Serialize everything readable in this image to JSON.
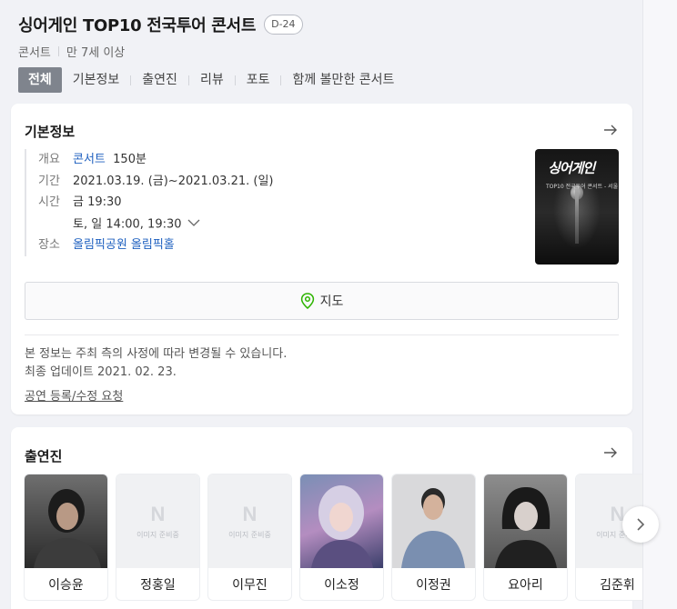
{
  "event": {
    "title": "싱어게인 TOP10 전국투어 콘서트",
    "dday": "D-24",
    "category": "콘서트",
    "age": "만 7세 이상"
  },
  "tabs": [
    "전체",
    "기본정보",
    "출연진",
    "리뷰",
    "포토",
    "함께 볼만한 콘서트"
  ],
  "basic_info": {
    "heading": "기본정보",
    "overview_label": "개요",
    "overview_genre": "콘서트",
    "overview_runtime": "150분",
    "period_label": "기간",
    "period_value": "2021.03.19. (금)~2021.03.21. (일)",
    "time_label": "시간",
    "time_value_1": "금 19:30",
    "time_value_2": "토, 일 14:00, 19:30",
    "venue_label": "장소",
    "venue_value": "올림픽공원 올림픽홀",
    "map_button": "지도",
    "notice": "본 정보는 주최 측의 사정에 따라 변경될 수 있습니다.",
    "updated": "최종 업데이트 2021. 02. 23.",
    "edit_request": "공연 등록/수정 요청",
    "poster": {
      "title": "싱어게인",
      "subtitle": "TOP10 전국투어 콘서트 - 서울"
    }
  },
  "cast_section": {
    "heading": "출연진",
    "placeholder_mark": "N",
    "placeholder_text": "이미지 준비중",
    "members": [
      {
        "name": "이승윤",
        "photo": true
      },
      {
        "name": "정홍일",
        "photo": false
      },
      {
        "name": "이무진",
        "photo": false
      },
      {
        "name": "이소정",
        "photo": true
      },
      {
        "name": "이정권",
        "photo": true
      },
      {
        "name": "요아리",
        "photo": true
      },
      {
        "name": "김준휘",
        "photo": false
      }
    ]
  },
  "colors": {
    "link_blue": "#1d5fbf",
    "active_tab": "#7f848d",
    "map_pin": "#2db400"
  }
}
